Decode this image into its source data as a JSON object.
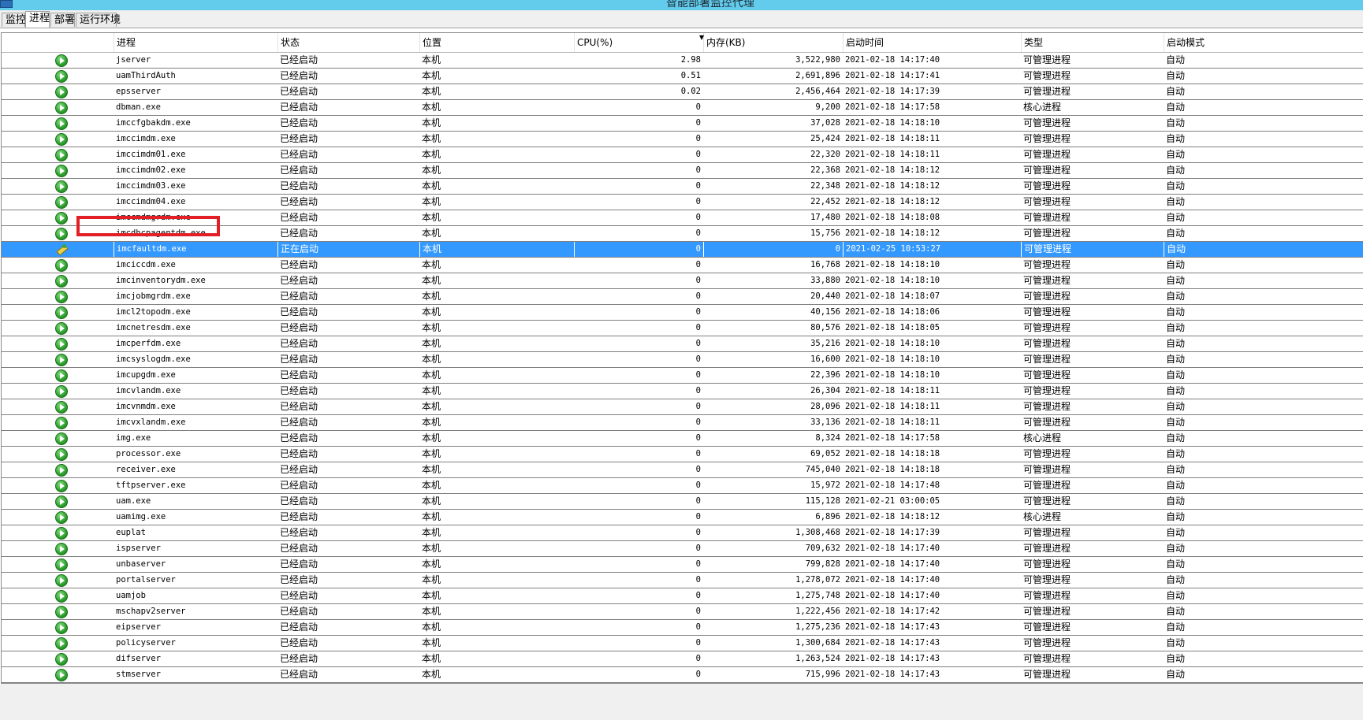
{
  "window": {
    "title": "智能部署监控代理"
  },
  "tabs": [
    "监控",
    "进程",
    "部署",
    "运行环境"
  ],
  "active_tab": 1,
  "columns": [
    "进程",
    "状态",
    "位置",
    "CPU(%)",
    "内存(KB)",
    "启动时间",
    "类型",
    "启动模式"
  ],
  "sort_column": "CPU(%)",
  "selected_row": 12,
  "rows": [
    {
      "name": "jserver",
      "status": "已经启动",
      "location": "本机",
      "cpu": "2.98",
      "memory": "3,522,980",
      "start_time": "2021-02-18 14:17:40",
      "type": "可管理进程",
      "mode": "自动",
      "icon": "running-icon"
    },
    {
      "name": "uamThirdAuth",
      "status": "已经启动",
      "location": "本机",
      "cpu": "0.51",
      "memory": "2,691,896",
      "start_time": "2021-02-18 14:17:41",
      "type": "可管理进程",
      "mode": "自动",
      "icon": "running-icon"
    },
    {
      "name": "epsserver",
      "status": "已经启动",
      "location": "本机",
      "cpu": "0.02",
      "memory": "2,456,464",
      "start_time": "2021-02-18 14:17:39",
      "type": "可管理进程",
      "mode": "自动",
      "icon": "running-icon"
    },
    {
      "name": "dbman.exe",
      "status": "已经启动",
      "location": "本机",
      "cpu": "0",
      "memory": "9,200",
      "start_time": "2021-02-18 14:17:58",
      "type": "核心进程",
      "mode": "自动",
      "icon": "running-icon"
    },
    {
      "name": "imccfgbakdm.exe",
      "status": "已经启动",
      "location": "本机",
      "cpu": "0",
      "memory": "37,028",
      "start_time": "2021-02-18 14:18:10",
      "type": "可管理进程",
      "mode": "自动",
      "icon": "running-icon"
    },
    {
      "name": "imccimdm.exe",
      "status": "已经启动",
      "location": "本机",
      "cpu": "0",
      "memory": "25,424",
      "start_time": "2021-02-18 14:18:11",
      "type": "可管理进程",
      "mode": "自动",
      "icon": "running-icon"
    },
    {
      "name": "imccimdm01.exe",
      "status": "已经启动",
      "location": "本机",
      "cpu": "0",
      "memory": "22,320",
      "start_time": "2021-02-18 14:18:11",
      "type": "可管理进程",
      "mode": "自动",
      "icon": "running-icon"
    },
    {
      "name": "imccimdm02.exe",
      "status": "已经启动",
      "location": "本机",
      "cpu": "0",
      "memory": "22,368",
      "start_time": "2021-02-18 14:18:12",
      "type": "可管理进程",
      "mode": "自动",
      "icon": "running-icon"
    },
    {
      "name": "imccimdm03.exe",
      "status": "已经启动",
      "location": "本机",
      "cpu": "0",
      "memory": "22,348",
      "start_time": "2021-02-18 14:18:12",
      "type": "可管理进程",
      "mode": "自动",
      "icon": "running-icon"
    },
    {
      "name": "imccimdm04.exe",
      "status": "已经启动",
      "location": "本机",
      "cpu": "0",
      "memory": "22,452",
      "start_time": "2021-02-18 14:18:12",
      "type": "可管理进程",
      "mode": "自动",
      "icon": "running-icon"
    },
    {
      "name": "imccmdmgrdm.exe",
      "status": "已经启动",
      "location": "本机",
      "cpu": "0",
      "memory": "17,480",
      "start_time": "2021-02-18 14:18:08",
      "type": "可管理进程",
      "mode": "自动",
      "icon": "running-icon"
    },
    {
      "name": "imcdhcpagentdm.exe",
      "status": "已经启动",
      "location": "本机",
      "cpu": "0",
      "memory": "15,756",
      "start_time": "2021-02-18 14:18:12",
      "type": "可管理进程",
      "mode": "自动",
      "icon": "running-icon"
    },
    {
      "name": "imcfaultdm.exe",
      "status": "正在启动",
      "location": "本机",
      "cpu": "0",
      "memory": "0",
      "start_time": "2021-02-25 10:53:27",
      "type": "可管理进程",
      "mode": "自动",
      "icon": "starting-icon"
    },
    {
      "name": "imciccdm.exe",
      "status": "已经启动",
      "location": "本机",
      "cpu": "0",
      "memory": "16,768",
      "start_time": "2021-02-18 14:18:10",
      "type": "可管理进程",
      "mode": "自动",
      "icon": "running-icon"
    },
    {
      "name": "imcinventorydm.exe",
      "status": "已经启动",
      "location": "本机",
      "cpu": "0",
      "memory": "33,880",
      "start_time": "2021-02-18 14:18:10",
      "type": "可管理进程",
      "mode": "自动",
      "icon": "running-icon"
    },
    {
      "name": "imcjobmgrdm.exe",
      "status": "已经启动",
      "location": "本机",
      "cpu": "0",
      "memory": "20,440",
      "start_time": "2021-02-18 14:18:07",
      "type": "可管理进程",
      "mode": "自动",
      "icon": "running-icon"
    },
    {
      "name": "imcl2topodm.exe",
      "status": "已经启动",
      "location": "本机",
      "cpu": "0",
      "memory": "40,156",
      "start_time": "2021-02-18 14:18:06",
      "type": "可管理进程",
      "mode": "自动",
      "icon": "running-icon"
    },
    {
      "name": "imcnetresdm.exe",
      "status": "已经启动",
      "location": "本机",
      "cpu": "0",
      "memory": "80,576",
      "start_time": "2021-02-18 14:18:05",
      "type": "可管理进程",
      "mode": "自动",
      "icon": "running-icon"
    },
    {
      "name": "imcperfdm.exe",
      "status": "已经启动",
      "location": "本机",
      "cpu": "0",
      "memory": "35,216",
      "start_time": "2021-02-18 14:18:10",
      "type": "可管理进程",
      "mode": "自动",
      "icon": "running-icon"
    },
    {
      "name": "imcsyslogdm.exe",
      "status": "已经启动",
      "location": "本机",
      "cpu": "0",
      "memory": "16,600",
      "start_time": "2021-02-18 14:18:10",
      "type": "可管理进程",
      "mode": "自动",
      "icon": "running-icon"
    },
    {
      "name": "imcupgdm.exe",
      "status": "已经启动",
      "location": "本机",
      "cpu": "0",
      "memory": "22,396",
      "start_time": "2021-02-18 14:18:10",
      "type": "可管理进程",
      "mode": "自动",
      "icon": "running-icon"
    },
    {
      "name": "imcvlandm.exe",
      "status": "已经启动",
      "location": "本机",
      "cpu": "0",
      "memory": "26,304",
      "start_time": "2021-02-18 14:18:11",
      "type": "可管理进程",
      "mode": "自动",
      "icon": "running-icon"
    },
    {
      "name": "imcvnmdm.exe",
      "status": "已经启动",
      "location": "本机",
      "cpu": "0",
      "memory": "28,096",
      "start_time": "2021-02-18 14:18:11",
      "type": "可管理进程",
      "mode": "自动",
      "icon": "running-icon"
    },
    {
      "name": "imcvxlandm.exe",
      "status": "已经启动",
      "location": "本机",
      "cpu": "0",
      "memory": "33,136",
      "start_time": "2021-02-18 14:18:11",
      "type": "可管理进程",
      "mode": "自动",
      "icon": "running-icon"
    },
    {
      "name": "img.exe",
      "status": "已经启动",
      "location": "本机",
      "cpu": "0",
      "memory": "8,324",
      "start_time": "2021-02-18 14:17:58",
      "type": "核心进程",
      "mode": "自动",
      "icon": "running-icon"
    },
    {
      "name": "processor.exe",
      "status": "已经启动",
      "location": "本机",
      "cpu": "0",
      "memory": "69,052",
      "start_time": "2021-02-18 14:18:18",
      "type": "可管理进程",
      "mode": "自动",
      "icon": "running-icon"
    },
    {
      "name": "receiver.exe",
      "status": "已经启动",
      "location": "本机",
      "cpu": "0",
      "memory": "745,040",
      "start_time": "2021-02-18 14:18:18",
      "type": "可管理进程",
      "mode": "自动",
      "icon": "running-icon"
    },
    {
      "name": "tftpserver.exe",
      "status": "已经启动",
      "location": "本机",
      "cpu": "0",
      "memory": "15,972",
      "start_time": "2021-02-18 14:17:48",
      "type": "可管理进程",
      "mode": "自动",
      "icon": "running-icon"
    },
    {
      "name": "uam.exe",
      "status": "已经启动",
      "location": "本机",
      "cpu": "0",
      "memory": "115,128",
      "start_time": "2021-02-21 03:00:05",
      "type": "可管理进程",
      "mode": "自动",
      "icon": "running-icon"
    },
    {
      "name": "uamimg.exe",
      "status": "已经启动",
      "location": "本机",
      "cpu": "0",
      "memory": "6,896",
      "start_time": "2021-02-18 14:18:12",
      "type": "核心进程",
      "mode": "自动",
      "icon": "running-icon"
    },
    {
      "name": "euplat",
      "status": "已经启动",
      "location": "本机",
      "cpu": "0",
      "memory": "1,308,468",
      "start_time": "2021-02-18 14:17:39",
      "type": "可管理进程",
      "mode": "自动",
      "icon": "running-icon"
    },
    {
      "name": "ispserver",
      "status": "已经启动",
      "location": "本机",
      "cpu": "0",
      "memory": "709,632",
      "start_time": "2021-02-18 14:17:40",
      "type": "可管理进程",
      "mode": "自动",
      "icon": "running-icon"
    },
    {
      "name": "unbaserver",
      "status": "已经启动",
      "location": "本机",
      "cpu": "0",
      "memory": "799,828",
      "start_time": "2021-02-18 14:17:40",
      "type": "可管理进程",
      "mode": "自动",
      "icon": "running-icon"
    },
    {
      "name": "portalserver",
      "status": "已经启动",
      "location": "本机",
      "cpu": "0",
      "memory": "1,278,072",
      "start_time": "2021-02-18 14:17:40",
      "type": "可管理进程",
      "mode": "自动",
      "icon": "running-icon"
    },
    {
      "name": "uamjob",
      "status": "已经启动",
      "location": "本机",
      "cpu": "0",
      "memory": "1,275,748",
      "start_time": "2021-02-18 14:17:40",
      "type": "可管理进程",
      "mode": "自动",
      "icon": "running-icon"
    },
    {
      "name": "mschapv2server",
      "status": "已经启动",
      "location": "本机",
      "cpu": "0",
      "memory": "1,222,456",
      "start_time": "2021-02-18 14:17:42",
      "type": "可管理进程",
      "mode": "自动",
      "icon": "running-icon"
    },
    {
      "name": "eipserver",
      "status": "已经启动",
      "location": "本机",
      "cpu": "0",
      "memory": "1,275,236",
      "start_time": "2021-02-18 14:17:43",
      "type": "可管理进程",
      "mode": "自动",
      "icon": "running-icon"
    },
    {
      "name": "policyserver",
      "status": "已经启动",
      "location": "本机",
      "cpu": "0",
      "memory": "1,300,684",
      "start_time": "2021-02-18 14:17:43",
      "type": "可管理进程",
      "mode": "自动",
      "icon": "running-icon"
    },
    {
      "name": "difserver",
      "status": "已经启动",
      "location": "本机",
      "cpu": "0",
      "memory": "1,263,524",
      "start_time": "2021-02-18 14:17:43",
      "type": "可管理进程",
      "mode": "自动",
      "icon": "running-icon"
    },
    {
      "name": "stmserver",
      "status": "已经启动",
      "location": "本机",
      "cpu": "0",
      "memory": "715,996",
      "start_time": "2021-02-18 14:17:43",
      "type": "可管理进程",
      "mode": "自动",
      "icon": "running-icon"
    }
  ],
  "colors": {
    "titlebar": "#63cbeb",
    "selection": "#3399ff",
    "highlight_box": "#e21f26"
  }
}
